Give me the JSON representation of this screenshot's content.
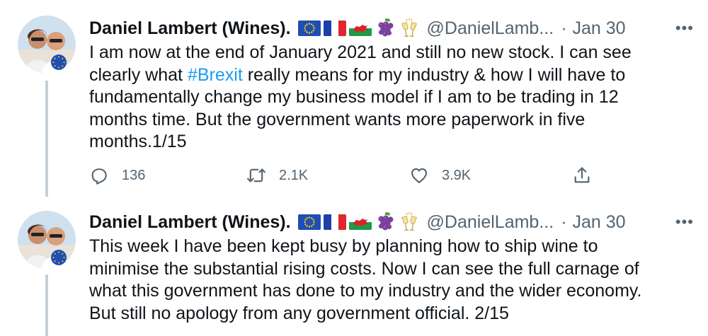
{
  "tweets": [
    {
      "author_name": "Daniel Lambert (Wines).",
      "handle": "@DanielLamb...",
      "separator": "·",
      "date": "Jan 30",
      "more_label": "•••",
      "text_lines": [
        [
          "I am now at the end of January 2021 and still no new stock. I can see"
        ],
        [
          "clearly what ",
          "#Brexit",
          " really means for my industry & how I will have to"
        ],
        [
          "fundamentally change my business model if I am to be trading in 12"
        ],
        [
          "months time. But the government wants more paperwork in five"
        ],
        [
          "months.1/15"
        ]
      ],
      "reply_count": "136",
      "retweet_count": "2.1K",
      "like_count": "3.9K"
    },
    {
      "author_name": "Daniel Lambert (Wines).",
      "handle": "@DanielLamb...",
      "separator": "·",
      "date": "Jan 30",
      "more_label": "•••",
      "text_lines": [
        [
          "This week I have been kept busy by planning how to ship wine to"
        ],
        [
          "minimise the substantial rising costs. Now I can see the full carnage of"
        ],
        [
          "what this government has done to my industry and the wider economy."
        ],
        [
          "But still no apology from any government official. 2/15"
        ]
      ]
    }
  ],
  "icons": {
    "name_emojis": [
      "eu-flag-icon",
      "france-flag-icon",
      "wales-flag-icon",
      "grapes-icon",
      "clinking-glasses-icon"
    ],
    "actions": [
      "reply-icon",
      "retweet-icon",
      "like-icon",
      "share-icon"
    ],
    "avatar_badge": "eu-flag-icon"
  },
  "colors": {
    "text": "#0f1419",
    "muted": "#536471",
    "link": "#1d9bf0",
    "thread_line": "#c4cfd6"
  }
}
